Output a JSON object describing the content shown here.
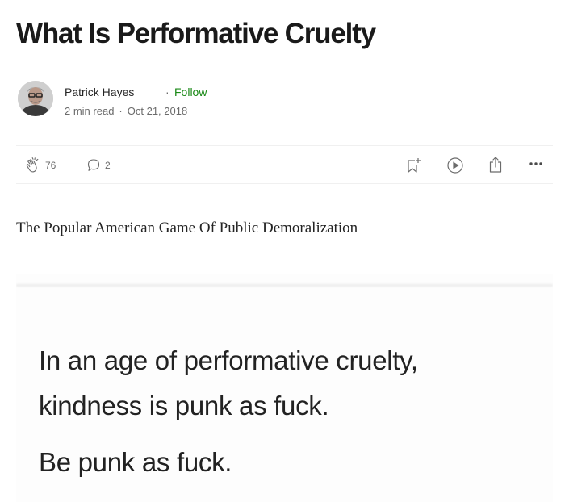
{
  "article": {
    "title": "What Is Performative Cruelty",
    "subtitle": "The Popular American Game Of Public Demoralization"
  },
  "author": {
    "name": "Patrick Hayes",
    "separator": "·",
    "follow_label": "Follow",
    "read_time": "2 min read",
    "date": "Oct 21, 2018"
  },
  "toolbar": {
    "claps": "76",
    "responses": "2",
    "icons": [
      "clap-icon",
      "comment-icon",
      "bookmark-add-icon",
      "play-icon",
      "share-icon",
      "more-icon"
    ]
  },
  "image": {
    "lines": [
      "In an age of performative cruelty,",
      "kindness is punk as fuck.",
      "Be punk as fuck."
    ]
  },
  "colors": {
    "follow": "#1a8917",
    "muted": "#6b6b6b",
    "text": "#242424"
  }
}
